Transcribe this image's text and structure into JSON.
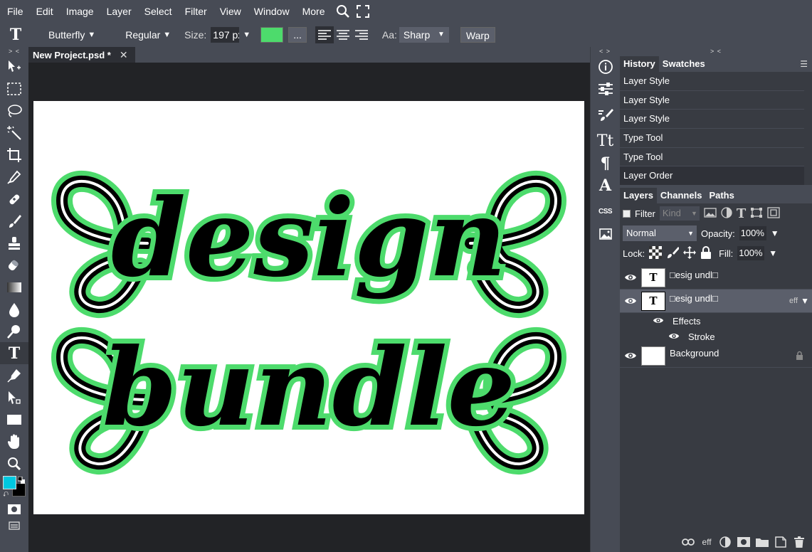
{
  "menu": {
    "items": [
      "File",
      "Edit",
      "Image",
      "Layer",
      "Select",
      "Filter",
      "View",
      "Window",
      "More"
    ]
  },
  "options": {
    "font_family": "Butterfly",
    "font_style": "Regular",
    "size_label": "Size:",
    "size_value": "197 px",
    "text_color": "#4ddb6c",
    "more_btn": "...",
    "aa_label": "Aa:",
    "aa_value": "Sharp",
    "warp_label": "Warp"
  },
  "document": {
    "tab_title": "New Project.psd *",
    "close_glyph": "✕"
  },
  "colors": {
    "foreground": "#00c8e0",
    "background": "#000000",
    "stroke": "#4ddb6c"
  },
  "history": {
    "tabs": [
      "History",
      "Swatches"
    ],
    "items": [
      "Layer Style",
      "Layer Style",
      "Layer Style",
      "Type Tool",
      "Type Tool",
      "Layer Order"
    ]
  },
  "layers": {
    "tabs": [
      "Layers",
      "Channels",
      "Paths"
    ],
    "filter_label": "Filter",
    "kind_label": "Kind",
    "blend_mode": "Normal",
    "opacity_label": "Opacity:",
    "opacity_value": "100%",
    "lock_label": "Lock:",
    "fill_label": "Fill:",
    "fill_value": "100%",
    "items": [
      {
        "name": "□esig    undl□",
        "type": "text"
      },
      {
        "name": "□esig    undl□",
        "type": "text",
        "badge": "eff"
      },
      {
        "name": "Background",
        "type": "raster"
      }
    ],
    "effects_label": "Effects",
    "stroke_label": "Stroke",
    "footer_eff": "eff"
  },
  "panel_collapse": "> <",
  "strip_collapse": "< >",
  "toolbar_collapse": "> <",
  "canvas_text": {
    "line1": "design",
    "line2": "bundle"
  }
}
